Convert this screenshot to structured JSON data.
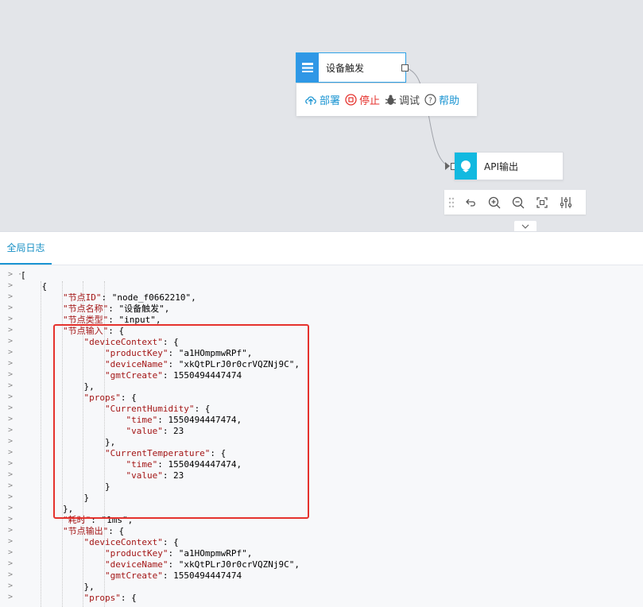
{
  "canvas": {
    "device_node": {
      "label": "设备触发"
    },
    "api_node": {
      "label": "API输出"
    },
    "node_toolbar": {
      "deploy": "部署",
      "stop": "停止",
      "debug": "调试",
      "help": "帮助"
    }
  },
  "panel": {
    "tab_label": "全局日志"
  },
  "log_lines": [
    "[",
    "    {",
    "        \"节点ID\": \"node_f0662210\",",
    "        \"节点名称\": \"设备触发\",",
    "        \"节点类型\": \"input\",",
    "        \"节点输入\": {",
    "            \"deviceContext\": {",
    "                \"productKey\": \"a1HOmpmwRPf\",",
    "                \"deviceName\": \"xkQtPLrJ0r0crVQZNj9C\",",
    "                \"gmtCreate\": 1550494447474",
    "            },",
    "            \"props\": {",
    "                \"CurrentHumidity\": {",
    "                    \"time\": 1550494447474,",
    "                    \"value\": 23",
    "                },",
    "                \"CurrentTemperature\": {",
    "                    \"time\": 1550494447474,",
    "                    \"value\": 23",
    "                }",
    "            }",
    "        },",
    "        \"耗时\": \"1ms\",",
    "        \"节点输出\": {",
    "            \"deviceContext\": {",
    "                \"productKey\": \"a1HOmpmwRPf\",",
    "                \"deviceName\": \"xkQtPLrJ0r0crVQZNj9C\",",
    "                \"gmtCreate\": 1550494447474",
    "            },",
    "            \"props\": {"
  ],
  "colors": {
    "accent": "#1a94d2",
    "stop": "#e5322d",
    "highlight_border": "#e5322d"
  },
  "icons": {
    "device_node": "device-trigger-icon",
    "api_node": "api-output-icon",
    "deploy": "cloud-upload-icon",
    "stop": "stop-icon",
    "debug": "bug-icon",
    "help": "question-icon",
    "zoom": [
      "drag-handle-icon",
      "undo-icon",
      "zoom-in-icon",
      "zoom-out-icon",
      "fit-view-icon",
      "settings-sliders-icon"
    ],
    "collapse": "chevron-down-icon"
  }
}
